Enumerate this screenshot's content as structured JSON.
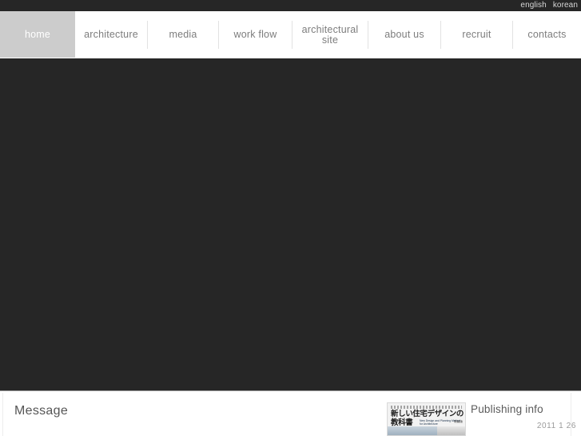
{
  "topbar": {
    "links": [
      {
        "label": "english",
        "name": "lang-link-english"
      },
      {
        "label": "korean",
        "name": "lang-link-korean"
      }
    ]
  },
  "nav": {
    "items": [
      {
        "label": "home",
        "active": true
      },
      {
        "label": "architecture",
        "active": false
      },
      {
        "label": "media",
        "active": false
      },
      {
        "label": "work flow",
        "active": false
      },
      {
        "label": "architectural\nsite",
        "active": false
      },
      {
        "label": "about us",
        "active": false
      },
      {
        "label": "recruit",
        "active": false
      },
      {
        "label": "contacts",
        "active": false
      }
    ]
  },
  "footer": {
    "message_title": "Message",
    "publishing": {
      "label": "Publishing info",
      "date": "2011 1 26",
      "book": {
        "title_line1": "新しい住宅デザインの",
        "title_line2": "教科書",
        "subtitle_en": "New Design and Planning Method for Architecture",
        "badge": "新装版"
      }
    }
  },
  "colors": {
    "dark": "#262626",
    "active_tab": "#cccccc",
    "nav_text": "#7d7d7d",
    "divider": "#e2e2e2",
    "footer_text": "#555555"
  }
}
